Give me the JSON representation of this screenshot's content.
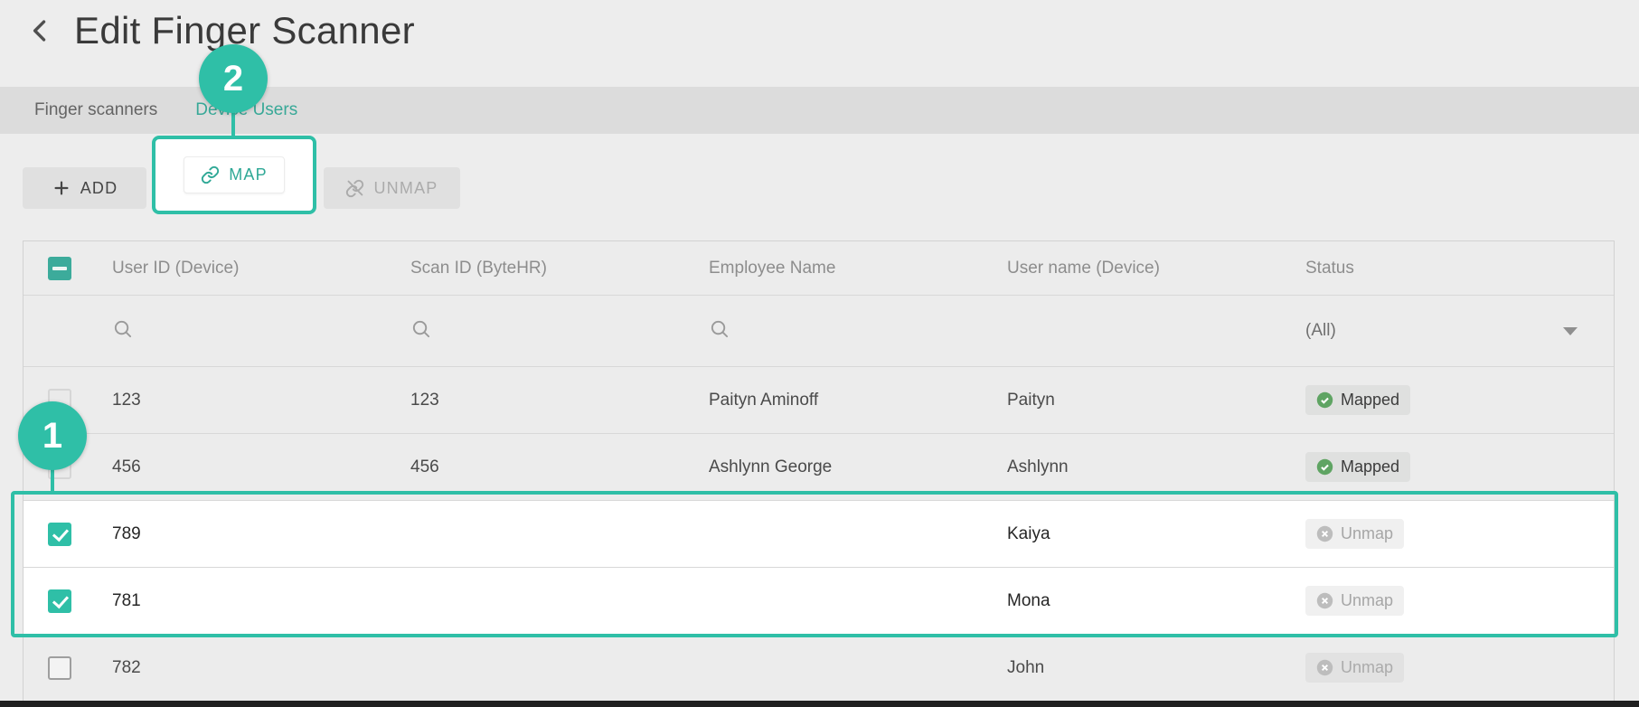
{
  "colors": {
    "accent": "#2fbfa7",
    "accent_text": "#38a897",
    "mapped_green": "#5fa463",
    "unmap_gray": "#bdbdbd",
    "tab_strip_bg": "#dcdcdc",
    "page_bg": "#ededed"
  },
  "header": {
    "title": "Edit Finger Scanner"
  },
  "tabs": [
    {
      "label": "Finger scanners",
      "active": false
    },
    {
      "label": "Device Users",
      "active": true
    }
  ],
  "toolbar": {
    "add_label": "ADD",
    "map_label": "MAP",
    "unmap_label": "UNMAP"
  },
  "annotations": {
    "step1": "1",
    "step2": "2"
  },
  "table": {
    "select_all_state": "indeterminate",
    "columns": [
      "User ID (Device)",
      "Scan ID (ByteHR)",
      "Employee Name",
      "User name (Device)",
      "Status"
    ],
    "status_filter_value": "(All)",
    "rows": [
      {
        "user_id": "123",
        "scan_id": "123",
        "employee_name": "Paityn Aminoff",
        "user_name": "Paityn",
        "status": "Mapped",
        "checked": false,
        "highlighted": false
      },
      {
        "user_id": "456",
        "scan_id": "456",
        "employee_name": "Ashlynn George",
        "user_name": "Ashlynn",
        "status": "Mapped",
        "checked": false,
        "highlighted": false
      },
      {
        "user_id": "789",
        "scan_id": "",
        "employee_name": "",
        "user_name": "Kaiya",
        "status": "Unmap",
        "checked": true,
        "highlighted": true
      },
      {
        "user_id": "781",
        "scan_id": "",
        "employee_name": "",
        "user_name": "Mona",
        "status": "Unmap",
        "checked": true,
        "highlighted": true
      },
      {
        "user_id": "782",
        "scan_id": "",
        "employee_name": "",
        "user_name": "John",
        "status": "Unmap",
        "checked": false,
        "highlighted": false
      }
    ]
  },
  "icons": {
    "back": "chevron-left",
    "add": "plus",
    "map": "link",
    "unmap": "link-off",
    "column_filter": "search",
    "status_dropdown": "caret-down",
    "mapped_badge": "check-circle",
    "unmap_badge": "x-circle"
  }
}
